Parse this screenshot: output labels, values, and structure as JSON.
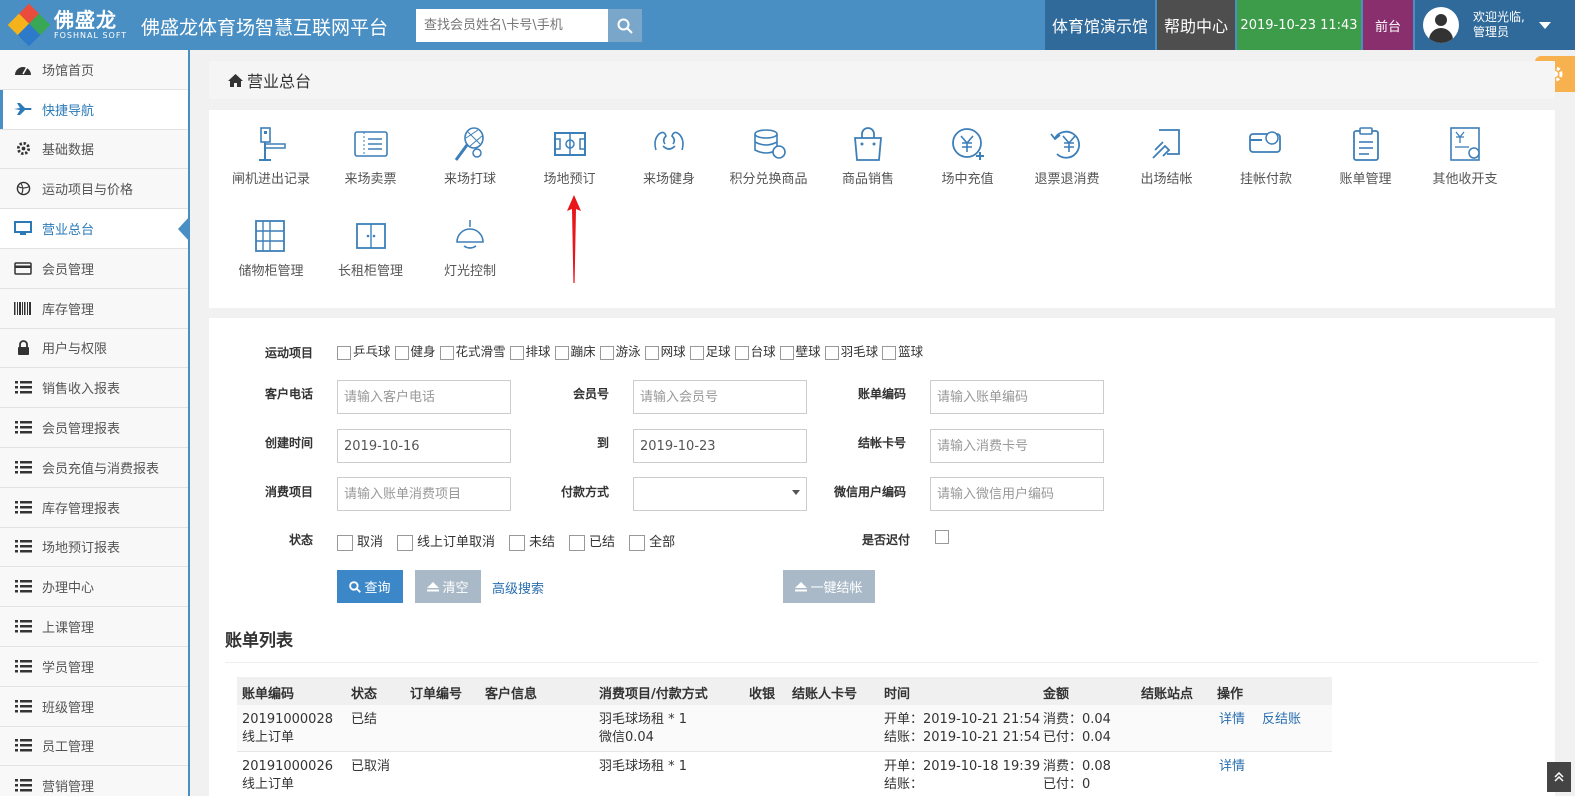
{
  "header": {
    "logo_cn": "佛盛龙",
    "logo_en": "FOSHNAL SOFT",
    "title": "佛盛龙体育场智慧互联网平台",
    "search_placeholder": "查找会员姓名\\卡号\\手机",
    "venue": "体育馆演示馆",
    "help": "帮助中心",
    "datetime": "2019-10-23 11:43",
    "front_desk": "前台",
    "welcome": "欢迎光临,",
    "user": "管理员"
  },
  "sidebar": {
    "items": [
      {
        "label": "场馆首页",
        "icon": "dashboard-icon"
      },
      {
        "label": "快捷导航",
        "icon": "plane-icon"
      },
      {
        "label": "基础数据",
        "icon": "gear-icon"
      },
      {
        "label": "运动项目与价格",
        "icon": "ball-icon"
      },
      {
        "label": "营业总台",
        "icon": "monitor-icon"
      },
      {
        "label": "会员管理",
        "icon": "card-icon"
      },
      {
        "label": "库存管理",
        "icon": "barcode-icon"
      },
      {
        "label": "用户与权限",
        "icon": "lock-icon"
      },
      {
        "label": "销售收入报表",
        "icon": "list-icon"
      },
      {
        "label": "会员管理报表",
        "icon": "list-icon"
      },
      {
        "label": "会员充值与消费报表",
        "icon": "list-icon"
      },
      {
        "label": "库存管理报表",
        "icon": "list-icon"
      },
      {
        "label": "场地预订报表",
        "icon": "list-icon"
      },
      {
        "label": "办理中心",
        "icon": "list-icon"
      },
      {
        "label": "上课管理",
        "icon": "list-icon"
      },
      {
        "label": "学员管理",
        "icon": "list-icon"
      },
      {
        "label": "班级管理",
        "icon": "list-icon"
      },
      {
        "label": "员工管理",
        "icon": "list-icon"
      },
      {
        "label": "营销管理",
        "icon": "list-icon"
      }
    ]
  },
  "breadcrumb": "营业总台",
  "tiles": [
    "闸机进出记录",
    "来场卖票",
    "来场打球",
    "场地预订",
    "来场健身",
    "积分兑换商品",
    "商品销售",
    "场中充值",
    "退票退消费",
    "出场结帐",
    "挂帐付款",
    "账单管理",
    "其他收开支",
    "储物柜管理",
    "长租柜管理",
    "灯光控制"
  ],
  "form": {
    "sport_label": "运动项目",
    "sports": [
      "乒乓球",
      "健身",
      "花式滑雪",
      "排球",
      "蹦床",
      "游泳",
      "网球",
      "足球",
      "台球",
      "壁球",
      "羽毛球",
      "篮球"
    ],
    "phone_label": "客户电话",
    "phone_ph": "请输入客户电话",
    "member_label": "会员号",
    "member_ph": "请输入会员号",
    "bill_label": "账单编码",
    "bill_ph": "请输入账单编码",
    "created_label": "创建时间",
    "created_from": "2019-10-16",
    "to_label": "到",
    "created_to": "2019-10-23",
    "card_label": "结帐卡号",
    "card_ph": "请输入消费卡号",
    "item_label": "消费项目",
    "item_ph": "请输入账单消费项目",
    "pay_label": "付款方式",
    "wechat_label": "微信用户编码",
    "wechat_ph": "请输入微信用户编码",
    "status_label": "状态",
    "statuses": [
      "取消",
      "线上订单取消",
      "未结",
      "已结",
      "全部"
    ],
    "late_label": "是否迟付",
    "query_btn": "查询",
    "clear_btn": "清空",
    "advanced": "高级搜索",
    "settle_btn": "一键结帐"
  },
  "list": {
    "title": "账单列表",
    "headers": [
      "账单编码",
      "状态",
      "订单编号",
      "客户信息",
      "消费项目/付款方式",
      "收银",
      "结账人卡号",
      "时间",
      "金额",
      "结账站点",
      "操作"
    ],
    "rows": [
      {
        "code": "20191000028",
        "code2": "线上订单",
        "status": "已结",
        "item": "羽毛球场租 * 1",
        "pay": "微信0.04",
        "open": "开单：2019-10-21 21:54",
        "close": "结账：2019-10-21 21:54",
        "consume": "消费：0.04",
        "paid": "已付：0.04",
        "op1": "详情",
        "op2": "反结账"
      },
      {
        "code": "20191000026",
        "code2": "线上订单",
        "status": "已取消",
        "item": "羽毛球场租 * 1",
        "pay": "",
        "open": "开单：2019-10-18 19:39",
        "close": "结账：",
        "consume": "消费：0.08",
        "paid": "已付：0",
        "op1": "详情",
        "op2": ""
      }
    ]
  }
}
